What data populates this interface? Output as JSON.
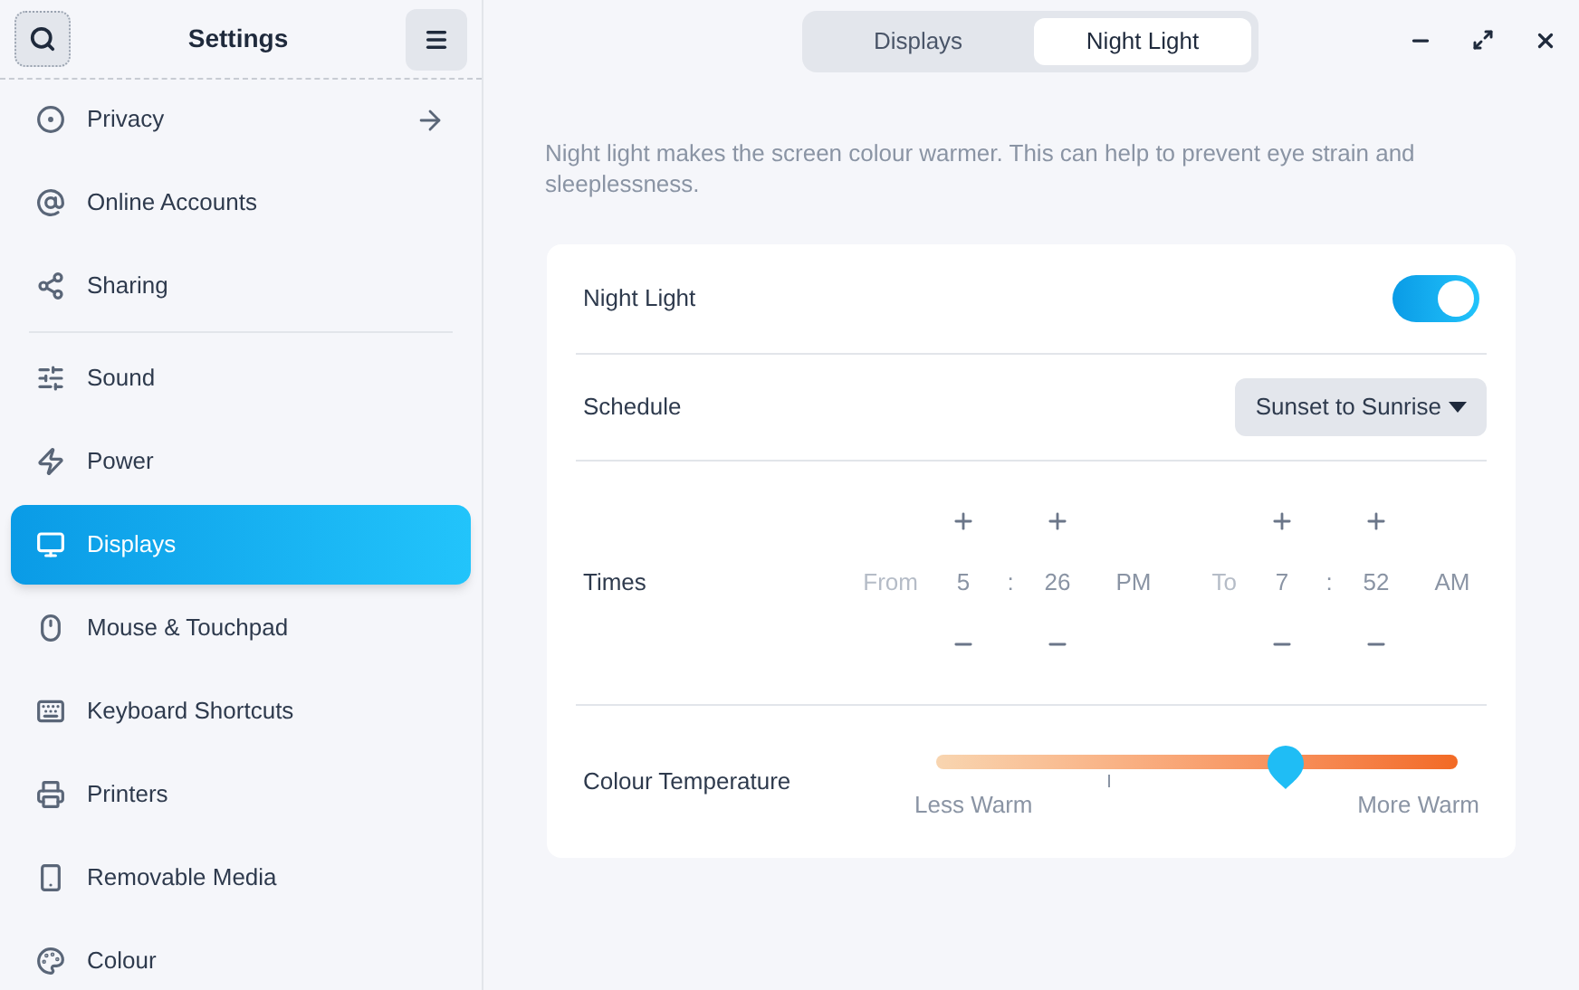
{
  "sidebar": {
    "title": "Settings",
    "items": [
      {
        "label": "Privacy",
        "selected": false,
        "arrow": true
      },
      {
        "label": "Online Accounts",
        "selected": false
      },
      {
        "label": "Sharing",
        "selected": false,
        "divider_after": true
      },
      {
        "label": "Sound",
        "selected": false
      },
      {
        "label": "Power",
        "selected": false
      },
      {
        "label": "Displays",
        "selected": true
      },
      {
        "label": "Mouse & Touchpad",
        "selected": false
      },
      {
        "label": "Keyboard Shortcuts",
        "selected": false
      },
      {
        "label": "Printers",
        "selected": false
      },
      {
        "label": "Removable Media",
        "selected": false
      },
      {
        "label": "Colour",
        "selected": false
      }
    ]
  },
  "tabs": [
    {
      "label": "Displays",
      "selected": false
    },
    {
      "label": "Night Light",
      "selected": true
    }
  ],
  "description": "Night light makes the screen colour warmer. This can help to prevent eye strain and sleeplessness.",
  "night_light": {
    "label": "Night Light",
    "on": true
  },
  "schedule": {
    "label": "Schedule",
    "value": "Sunset to Sunrise"
  },
  "times": {
    "label": "Times",
    "from": {
      "label": "From",
      "hour": "5",
      "separator": ":",
      "minute": "26",
      "period": "PM"
    },
    "to": {
      "label": "To",
      "hour": "7",
      "separator": ":",
      "minute": "52",
      "period": "AM"
    }
  },
  "colour_temperature": {
    "label": "Colour Temperature",
    "level": 0.67,
    "min_label": "Less Warm",
    "max_label": "More Warm"
  }
}
